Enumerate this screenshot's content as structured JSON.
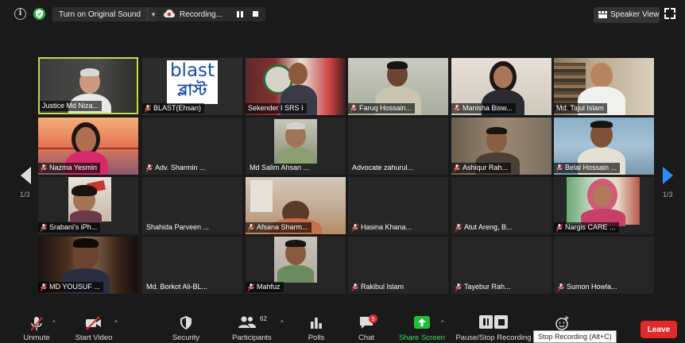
{
  "topbar": {
    "original_sound": "Turn on Original Sound",
    "recording": "Recording...",
    "speaker_view": "Speaker View"
  },
  "pagination": {
    "left": "1/3",
    "right": "1/3"
  },
  "participants": [
    {
      "name": "Justice Md Niza...",
      "muted": false,
      "active": true
    },
    {
      "name": "BLAST(Ehsan)",
      "muted": true,
      "logo_text_top": "blast",
      "logo_text_bottom": "ব্লাস্ট"
    },
    {
      "name": "Sekender I SRS I",
      "muted": false
    },
    {
      "name": "Faruq Hossain...",
      "muted": true
    },
    {
      "name": "Manisha Bisw...",
      "muted": true
    },
    {
      "name": "Md. Tajul Islam",
      "muted": false
    },
    {
      "name": "Nazma Yesmin",
      "muted": true
    },
    {
      "name": "Adv. Sharmin ...",
      "muted": true
    },
    {
      "name": "Md Salim Ahsan ...",
      "muted": false
    },
    {
      "name": "Advocate zahurul...",
      "muted": false
    },
    {
      "name": "Ashiqur Rah...",
      "muted": true
    },
    {
      "name": "Belal Hossain ...",
      "muted": true
    },
    {
      "name": "Srabani's iPh...",
      "muted": true
    },
    {
      "name": "Shahida Parveen ...",
      "muted": false
    },
    {
      "name": "Afsana Sharm...",
      "muted": true
    },
    {
      "name": "Hasina Khana...",
      "muted": true
    },
    {
      "name": "Atut Areng, B...",
      "muted": true
    },
    {
      "name": "Nargis CARE ...",
      "muted": true
    },
    {
      "name": "MD YOUSUF ...",
      "muted": true
    },
    {
      "name": "Md. Borkot Ali-BL...",
      "muted": false
    },
    {
      "name": "Mahfuz",
      "muted": true
    },
    {
      "name": "Rakibul Islam",
      "muted": true
    },
    {
      "name": "Tayebur Rah...",
      "muted": true
    },
    {
      "name": "Sumon Howla...",
      "muted": true
    }
  ],
  "toolbar": {
    "unmute": "Unmute",
    "start_video": "Start Video",
    "security": "Security",
    "participants": "Participants",
    "participants_count": "62",
    "polls": "Polls",
    "chat": "Chat",
    "chat_badge": "5",
    "share_screen": "Share Screen",
    "pause_stop": "Pause/Stop Recording",
    "tooltip": "Stop Recording (Alt+C)",
    "leave": "Leave"
  },
  "colors": {
    "active_speaker_border": "#c6d64a",
    "share_green": "#1fbf3a",
    "leave_red": "#e02b2b",
    "accent_blue": "#2d8cff"
  }
}
